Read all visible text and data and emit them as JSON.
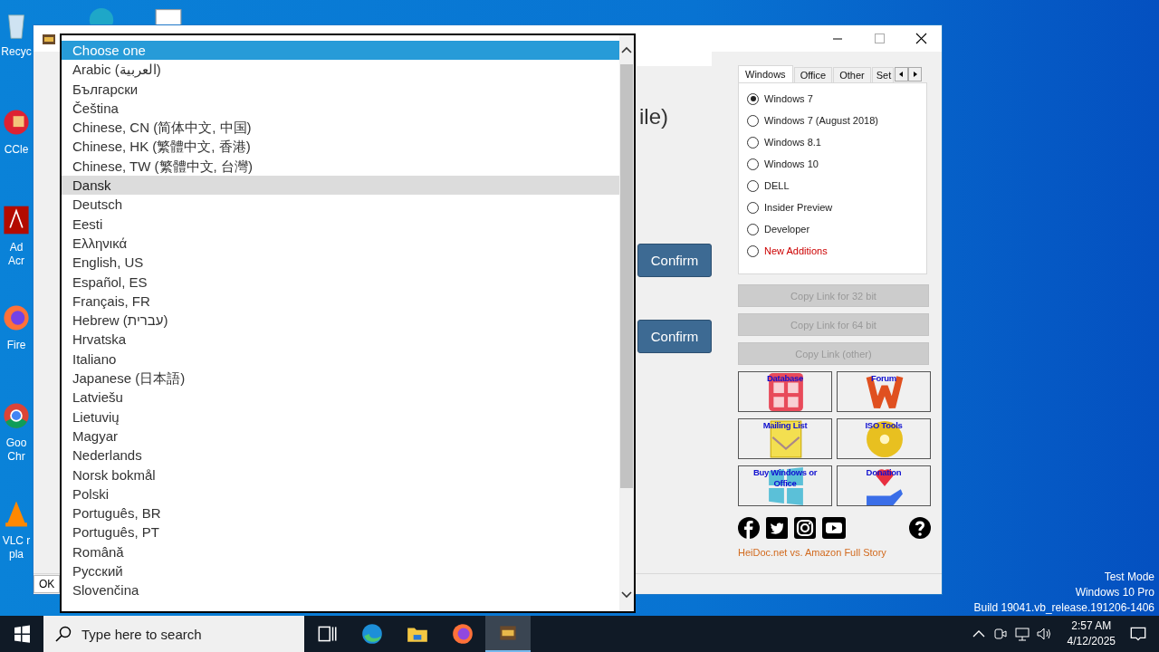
{
  "desktop_icons": [
    {
      "kind": "recycle",
      "label": "Recyc"
    },
    {
      "kind": "ccleaner",
      "label": "CCle"
    },
    {
      "kind": "acrobat",
      "label": "Ad Acr"
    },
    {
      "kind": "firefox",
      "label": "Fire"
    },
    {
      "kind": "chrome",
      "label": "Goo Chr"
    },
    {
      "kind": "vlc",
      "label": "VLC r pla"
    }
  ],
  "window": {
    "heading": "ile)",
    "confirm_buttons": [
      "Confirm",
      "Confirm"
    ],
    "status_bar": "OK"
  },
  "tabs": [
    {
      "label": "Windows",
      "selected": true
    },
    {
      "label": "Office",
      "selected": false
    },
    {
      "label": "Other",
      "selected": false
    },
    {
      "label": "Set",
      "selected": false
    }
  ],
  "radios": [
    {
      "label": "Windows 7",
      "selected": true
    },
    {
      "label": "Windows 7 (August 2018)",
      "selected": false
    },
    {
      "label": "Windows 8.1",
      "selected": false
    },
    {
      "label": "Windows 10",
      "selected": false
    },
    {
      "label": "DELL",
      "selected": false
    },
    {
      "label": "Insider Preview",
      "selected": false
    },
    {
      "label": "Developer",
      "selected": false
    },
    {
      "label": "New Additions",
      "selected": false,
      "color": "#cc0000"
    }
  ],
  "copy_buttons": [
    {
      "label": "Copy Link for 32 bit",
      "disabled": true
    },
    {
      "label": "Copy Link for 64 bit",
      "disabled": true
    },
    {
      "label": "Copy Link (other)",
      "disabled": true
    }
  ],
  "tiles": [
    {
      "kind": "database",
      "label": "Database"
    },
    {
      "kind": "forum",
      "label": "Forum"
    },
    {
      "kind": "mail",
      "label": "Mailing List"
    },
    {
      "kind": "disc",
      "label": "ISO Tools"
    },
    {
      "kind": "windows",
      "label": "Buy Windows or Office"
    },
    {
      "kind": "donation",
      "label": "Donation"
    }
  ],
  "link": "HeiDoc.net vs. Amazon Full Story",
  "dropdown": [
    {
      "label": "Choose one",
      "selected": true,
      "hovered": false
    },
    {
      "label": "Arabic (العربية)",
      "selected": false,
      "hovered": false
    },
    {
      "label": "Български",
      "selected": false,
      "hovered": false
    },
    {
      "label": "Čeština",
      "selected": false,
      "hovered": false
    },
    {
      "label": "Chinese, CN (简体中文, 中国)",
      "selected": false,
      "hovered": false
    },
    {
      "label": "Chinese, HK (繁體中文, 香港)",
      "selected": false,
      "hovered": false
    },
    {
      "label": "Chinese, TW (繁體中文, 台灣)",
      "selected": false,
      "hovered": false
    },
    {
      "label": "Dansk",
      "selected": false,
      "hovered": true
    },
    {
      "label": "Deutsch",
      "selected": false,
      "hovered": false
    },
    {
      "label": "Eesti",
      "selected": false,
      "hovered": false
    },
    {
      "label": "Ελληνικά",
      "selected": false,
      "hovered": false
    },
    {
      "label": "English, US",
      "selected": false,
      "hovered": false
    },
    {
      "label": "Español, ES",
      "selected": false,
      "hovered": false
    },
    {
      "label": "Français, FR",
      "selected": false,
      "hovered": false
    },
    {
      "label": "Hebrew (עברית)",
      "selected": false,
      "hovered": false
    },
    {
      "label": "Hrvatska",
      "selected": false,
      "hovered": false
    },
    {
      "label": "Italiano",
      "selected": false,
      "hovered": false
    },
    {
      "label": "Japanese (日本語)",
      "selected": false,
      "hovered": false
    },
    {
      "label": "Latviešu",
      "selected": false,
      "hovered": false
    },
    {
      "label": "Lietuvių",
      "selected": false,
      "hovered": false
    },
    {
      "label": "Magyar",
      "selected": false,
      "hovered": false
    },
    {
      "label": "Nederlands",
      "selected": false,
      "hovered": false
    },
    {
      "label": "Norsk bokmål",
      "selected": false,
      "hovered": false
    },
    {
      "label": "Polski",
      "selected": false,
      "hovered": false
    },
    {
      "label": "Português, BR",
      "selected": false,
      "hovered": false
    },
    {
      "label": "Português, PT",
      "selected": false,
      "hovered": false
    },
    {
      "label": "Română",
      "selected": false,
      "hovered": false
    },
    {
      "label": "Русский",
      "selected": false,
      "hovered": false
    },
    {
      "label": "Slovenčina",
      "selected": false,
      "hovered": false
    }
  ],
  "watermark": [
    "Test Mode",
    "Windows 10 Pro",
    "Build 19041.vb_release.191206-1406"
  ],
  "taskbar": {
    "search": {
      "placeholder": "Type here to search"
    },
    "apps": [
      {
        "kind": "taskview",
        "selected": false
      },
      {
        "kind": "edge",
        "selected": false
      },
      {
        "kind": "explorer",
        "selected": false
      },
      {
        "kind": "firefox",
        "selected": false
      },
      {
        "kind": "app",
        "selected": true
      }
    ],
    "time": "2:57 AM",
    "date": "4/12/2025"
  }
}
